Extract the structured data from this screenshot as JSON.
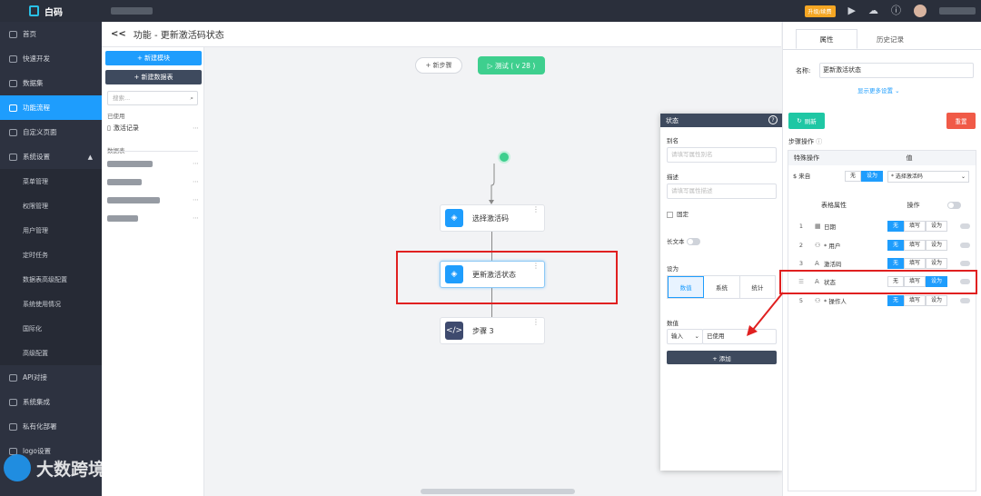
{
  "app": {
    "name": "白码"
  },
  "topbar": {
    "upgrade": "升级/续费",
    "icons": [
      "play-icon",
      "cloud-icon",
      "info-icon"
    ]
  },
  "sidebar": {
    "items": [
      {
        "label": "首页",
        "icon": "home-icon"
      },
      {
        "label": "快速开发",
        "icon": "rocket-icon"
      },
      {
        "label": "数据集",
        "icon": "database-icon"
      },
      {
        "label": "功能流程",
        "icon": "flow-icon",
        "active": true
      },
      {
        "label": "自定义页面",
        "icon": "page-icon"
      },
      {
        "label": "系统设置",
        "icon": "settings-icon",
        "expanded": true
      }
    ],
    "subitems": [
      "菜单管理",
      "权限管理",
      "用户管理",
      "定时任务",
      "数据表高级配置",
      "系统使用情况",
      "国际化",
      "高级配置"
    ],
    "items2": [
      {
        "label": "API对接",
        "icon": "api-icon"
      },
      {
        "label": "系统集成",
        "icon": "integration-icon"
      },
      {
        "label": "私有化部署",
        "icon": "deploy-icon"
      },
      {
        "label": "logo设置",
        "icon": "logo-icon"
      }
    ]
  },
  "header": {
    "back": "<<",
    "title": "功能 - 更新激活码状态"
  },
  "module_panel": {
    "new_module": "+ 新建模块",
    "new_table": "+ 新建数据表",
    "search_placeholder": "搜索...",
    "used_label": "已使用",
    "used_item": "激活记录",
    "data_table_label": "数据表"
  },
  "canvas": {
    "add_step": "+ 新步骤",
    "test": "▷ 测试 ( v 28 )",
    "nodes": [
      {
        "label": "选择激活码",
        "icon": "cube-icon"
      },
      {
        "label": "更新激活状态",
        "icon": "cube-icon"
      },
      {
        "label": "步骤 3",
        "icon": "code-icon"
      }
    ]
  },
  "state_panel": {
    "title": "状态",
    "alias_label": "别名",
    "alias_placeholder": "请填写属性别名",
    "desc_label": "描述",
    "desc_placeholder": "请填写属性描述",
    "fixed": "固定",
    "long_text": "长文本",
    "set_to": "设为",
    "seg": [
      "数值",
      "系统",
      "统计"
    ],
    "value_label": "数值",
    "input_type": "输入",
    "value": "已使用",
    "add": "+ 添加"
  },
  "right_panel": {
    "tabs": [
      "属性",
      "历史记录"
    ],
    "name_label": "名称:",
    "name_value": "更新激活状态",
    "more": "显示更多设置 ⌄",
    "refresh": "刷新",
    "reset": "重置",
    "step_ops": "步骤操作",
    "special_ops": "特殊操作",
    "value_col": "值",
    "source_label": "$ 来自",
    "none": "无",
    "set": "设为",
    "select_code": "* 选择激活码",
    "attr_col": "表格属性",
    "op_col": "操作",
    "fill": "填写",
    "rows": [
      {
        "idx": "1",
        "icon": "calendar-icon",
        "name": "日期",
        "selected": "none"
      },
      {
        "idx": "2",
        "icon": "user-icon",
        "name": "* 用户",
        "selected": "none"
      },
      {
        "idx": "3",
        "icon": "text-icon",
        "name": "激活码",
        "selected": "none"
      },
      {
        "idx": "",
        "icon": "text-icon",
        "name": "状态",
        "selected": "set"
      },
      {
        "idx": "5",
        "icon": "user-icon",
        "name": "* 操作人",
        "selected": "none"
      }
    ]
  },
  "watermark": "大数跨境"
}
